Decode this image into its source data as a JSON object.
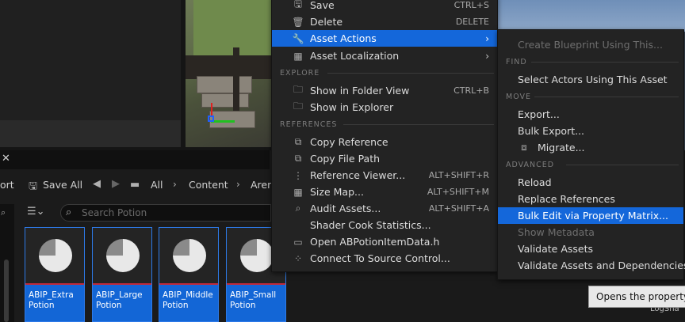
{
  "toolbar": {
    "import_label": "ort",
    "save_all_label": "Save All",
    "path": [
      "All",
      "Content",
      "Aren"
    ]
  },
  "search": {
    "placeholder": "Search Potion"
  },
  "assets": [
    {
      "name": "ABIP_Extra Potion"
    },
    {
      "name": "ABIP_Large Potion"
    },
    {
      "name": "ABIP_Middle Potion"
    },
    {
      "name": "ABIP_Small Potion"
    }
  ],
  "context_menu": {
    "items_top": [
      {
        "label": "Save",
        "shortcut": "CTRL+S",
        "icon": "save-icon"
      },
      {
        "label": "Delete",
        "shortcut": "DELETE",
        "icon": "trash-icon"
      },
      {
        "label": "Asset Actions",
        "icon": "wrench-icon"
      },
      {
        "label": "Asset Localization",
        "icon": "localization-icon"
      }
    ],
    "section_explore": "EXPLORE",
    "items_explore": [
      {
        "label": "Show in Folder View",
        "shortcut": "CTRL+B",
        "icon": "folder-search-icon"
      },
      {
        "label": "Show in Explorer",
        "icon": "folder-search-icon"
      }
    ],
    "section_references": "REFERENCES",
    "items_references": [
      {
        "label": "Copy Reference",
        "icon": "copy-icon"
      },
      {
        "label": "Copy File Path",
        "icon": "copy-icon"
      },
      {
        "label": "Reference Viewer...",
        "shortcut": "ALT+SHIFT+R",
        "icon": "graph-icon"
      },
      {
        "label": "Size Map...",
        "shortcut": "ALT+SHIFT+M",
        "icon": "grid-icon"
      },
      {
        "label": "Audit Assets...",
        "shortcut": "ALT+SHIFT+A",
        "icon": "audit-icon"
      },
      {
        "label": "Shader Cook Statistics..."
      },
      {
        "label": "Open ABPotionItemData.h",
        "icon": "code-file-icon"
      },
      {
        "label": "Connect To Source Control...",
        "icon": "source-control-icon"
      }
    ]
  },
  "submenu": {
    "create_blueprint": "Create Blueprint Using This...",
    "section_find": "FIND",
    "select_actors": "Select Actors Using This Asset",
    "section_move": "MOVE",
    "export": "Export...",
    "bulk_export": "Bulk Export...",
    "migrate": "Migrate...",
    "section_advanced": "ADVANCED",
    "reload": "Reload",
    "replace_references": "Replace References",
    "bulk_edit": "Bulk Edit via Property Matrix...",
    "show_metadata": "Show Metadata",
    "validate_assets": "Validate Assets",
    "validate_deps": "Validate Assets and Dependencies"
  },
  "tooltip": "Opens the property m",
  "log_text": "LogSha",
  "colors": {
    "highlight": "#1467da",
    "tile": "#1366d6",
    "menu_bg": "#232323"
  }
}
